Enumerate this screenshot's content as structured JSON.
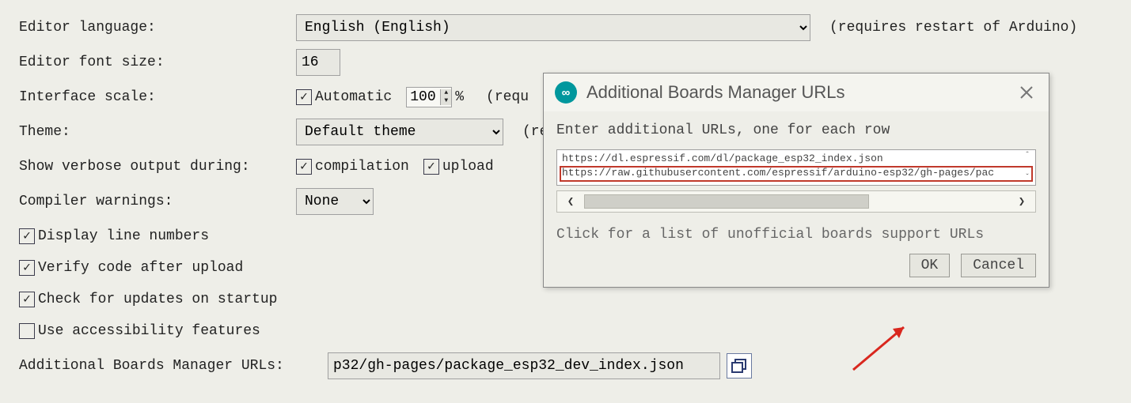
{
  "prefs": {
    "language": {
      "label": "Editor language:",
      "value": "English (English)",
      "note": "(requires restart of Arduino)"
    },
    "fontsize": {
      "label": "Editor font size:",
      "value": "16"
    },
    "scale": {
      "label": "Interface scale:",
      "auto_label": "Automatic",
      "value": "100",
      "pct": "%",
      "note": "(requ"
    },
    "theme": {
      "label": "Theme:",
      "value": "Default theme",
      "note": "(require"
    },
    "verbose": {
      "label": "Show verbose output during:",
      "compile": "compilation",
      "upload": "upload"
    },
    "warnings": {
      "label": "Compiler warnings:",
      "value": "None"
    },
    "checks": {
      "linenums": "Display line numbers",
      "verify": "Verify code after upload",
      "updates": "Check for updates on startup",
      "a11y": "Use accessibility features"
    },
    "urls": {
      "label": "Additional Boards Manager URLs:",
      "value": "p32/gh-pages/package_esp32_dev_index.json"
    }
  },
  "dialog": {
    "icon_text": "∞",
    "title": "Additional Boards Manager URLs",
    "prompt": "Enter additional URLs, one for each row",
    "lines": [
      "https://dl.espressif.com/dl/package_esp32_index.json",
      "https://raw.githubusercontent.com/espressif/arduino-esp32/gh-pages/pac"
    ],
    "hint": "Click for a list of unofficial boards support URLs",
    "ok": "OK",
    "cancel": "Cancel"
  }
}
